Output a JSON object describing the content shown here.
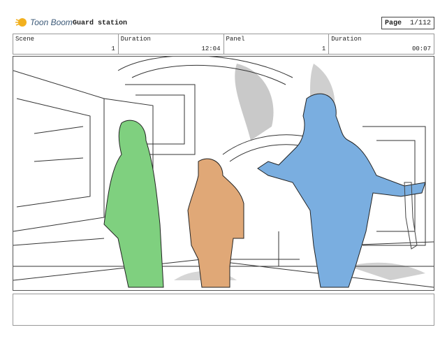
{
  "header": {
    "logo_text": "Toon Boom",
    "project_title": "Guard station",
    "page_label": "Page",
    "page_value": "1/112"
  },
  "info": {
    "scene_label": "Scene",
    "scene_value": "1",
    "duration1_label": "Duration",
    "duration1_value": "12:04",
    "panel_label": "Panel",
    "panel_value": "1",
    "duration2_label": "Duration",
    "duration2_value": "00:07"
  },
  "colors": {
    "green_character": "#7fd07f",
    "orange_character": "#e0a877",
    "blue_character": "#7aaee0",
    "logo_accent": "#f2b01e"
  },
  "icons": {
    "logo": "toon-boom-logo-icon"
  }
}
